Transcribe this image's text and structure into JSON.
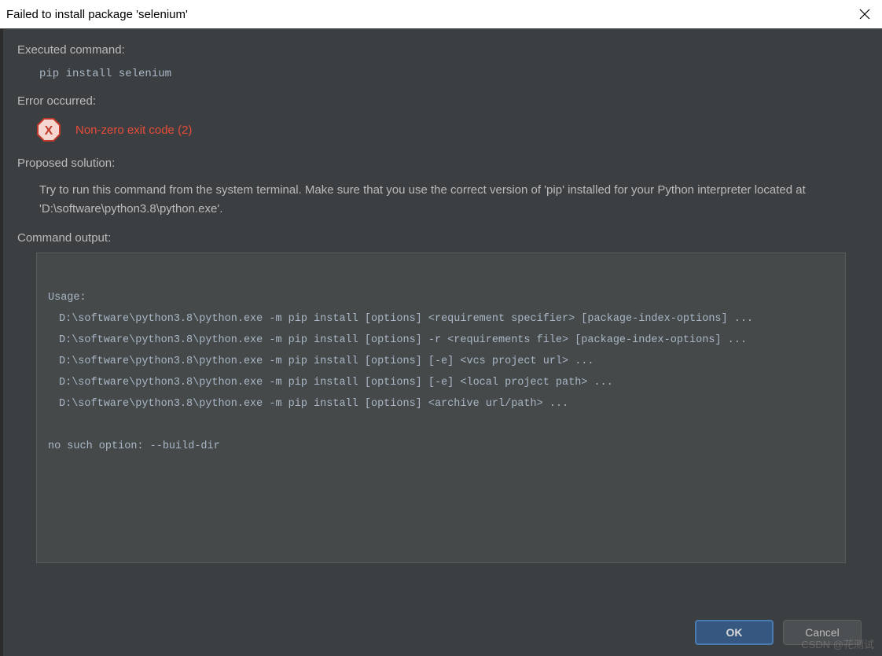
{
  "titlebar": {
    "title": "Failed to install package 'selenium'"
  },
  "sections": {
    "executed_label": "Executed command:",
    "executed_command": "pip install selenium",
    "error_label": "Error occurred:",
    "error_message": "Non-zero exit code (2)",
    "solution_label": "Proposed solution:",
    "solution_text": "Try to run this command from the system terminal. Make sure that you use the correct version of 'pip' installed for your Python interpreter located at 'D:\\software\\python3.8\\python.exe'.",
    "output_label": "Command output:"
  },
  "output": {
    "usage_header": "Usage:",
    "lines": [
      "D:\\software\\python3.8\\python.exe -m pip install [options] <requirement specifier> [package-index-options] ...",
      "D:\\software\\python3.8\\python.exe -m pip install [options] -r <requirements file> [package-index-options] ...",
      "D:\\software\\python3.8\\python.exe -m pip install [options] [-e] <vcs project url> ...",
      "D:\\software\\python3.8\\python.exe -m pip install [options] [-e] <local project path> ...",
      "D:\\software\\python3.8\\python.exe -m pip install [options] <archive url/path> ..."
    ],
    "error_line": "no such option: --build-dir"
  },
  "buttons": {
    "ok": "OK",
    "cancel": "Cancel"
  },
  "watermark": "CSDN @花测试"
}
